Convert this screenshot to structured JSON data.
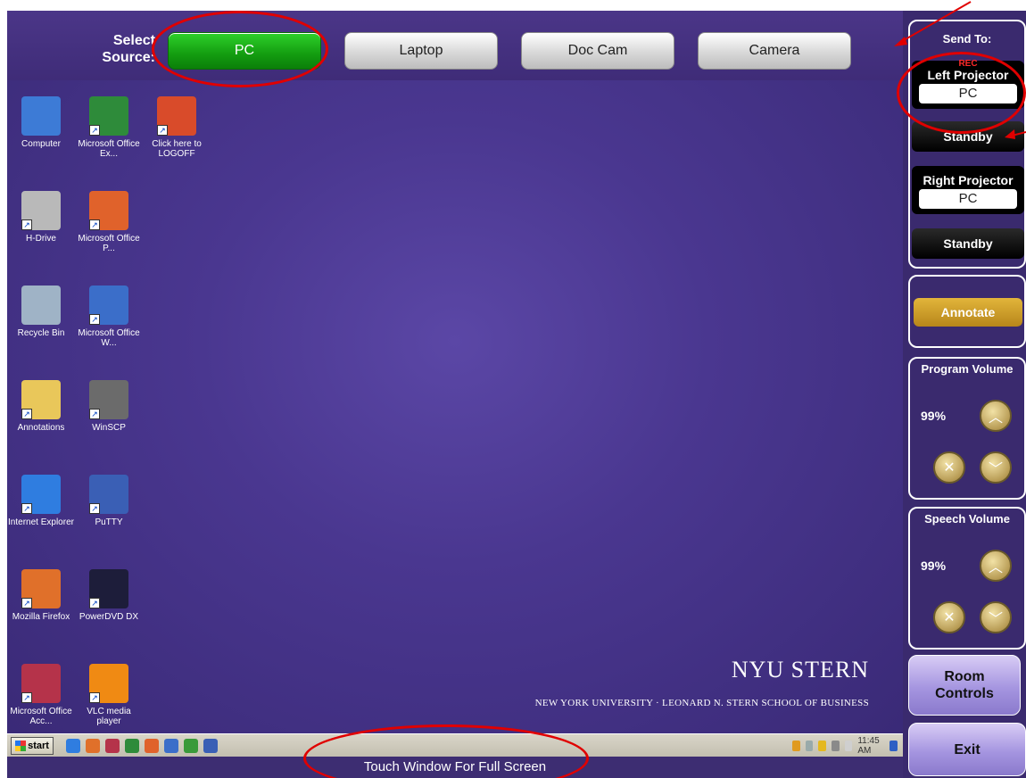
{
  "source_bar": {
    "label": "Select Source:",
    "buttons": [
      {
        "label": "PC",
        "active": true
      },
      {
        "label": "Laptop",
        "active": false
      },
      {
        "label": "Doc Cam",
        "active": false
      },
      {
        "label": "Camera",
        "active": false
      }
    ]
  },
  "desktop": {
    "icons": [
      {
        "label": "Computer",
        "icon": "computer-icon",
        "color": "#3d7bd6"
      },
      {
        "label": "Microsoft Office Ex...",
        "icon": "excel-icon",
        "color": "#2e8b3a"
      },
      {
        "label": "Click here to LOGOFF",
        "icon": "logoff-icon",
        "color": "#d94b2a"
      },
      {
        "label": "H-Drive",
        "icon": "network-drive-icon",
        "color": "#b9b9b9"
      },
      {
        "label": "Microsoft Office P...",
        "icon": "powerpoint-icon",
        "color": "#e0622b"
      },
      {
        "label": "Recycle Bin",
        "icon": "recycle-bin-icon",
        "color": "#9fb3c6"
      },
      {
        "label": "Microsoft Office W...",
        "icon": "word-icon",
        "color": "#3b6ec9"
      },
      {
        "label": "Annotations",
        "icon": "folder-icon",
        "color": "#e9c75a"
      },
      {
        "label": "WinSCP",
        "icon": "winscp-icon",
        "color": "#6b6b6b"
      },
      {
        "label": "Internet Explorer",
        "icon": "internet-explorer-icon",
        "color": "#2f7de0"
      },
      {
        "label": "PuTTY",
        "icon": "putty-icon",
        "color": "#3a5fb5"
      },
      {
        "label": "Mozilla Firefox",
        "icon": "firefox-icon",
        "color": "#e0702a"
      },
      {
        "label": "PowerDVD DX",
        "icon": "powerdvd-icon",
        "color": "#1d1d3a"
      },
      {
        "label": "Microsoft Office Acc...",
        "icon": "access-icon",
        "color": "#b5334a"
      },
      {
        "label": "VLC media player",
        "icon": "vlc-icon",
        "color": "#f08a13"
      }
    ],
    "logo": {
      "main": "NYU STERN",
      "sub": "NEW YORK UNIVERSITY · LEONARD N. STERN SCHOOL OF BUSINESS"
    }
  },
  "taskbar": {
    "start_label": "start",
    "quick_launch": [
      "internet-explorer-icon",
      "firefox-icon",
      "access-icon",
      "excel-icon",
      "powerpoint-icon",
      "word-icon",
      "winscp-icon",
      "putty-icon"
    ],
    "clock": "11:45 AM"
  },
  "touch_label": "Touch Window For Full Screen",
  "right_panel": {
    "send_to": {
      "title": "Send To:",
      "rec": "REC",
      "left_projector": {
        "title": "Left Projector",
        "value": "PC",
        "standby": "Standby"
      },
      "right_projector": {
        "title": "Right Projector",
        "value": "PC",
        "standby": "Standby"
      }
    },
    "annotate_label": "Annotate",
    "program_volume": {
      "title": "Program Volume",
      "value": "99%"
    },
    "speech_volume": {
      "title": "Speech Volume",
      "value": "99%"
    },
    "room_controls_label": "Room Controls",
    "exit_label": "Exit"
  }
}
